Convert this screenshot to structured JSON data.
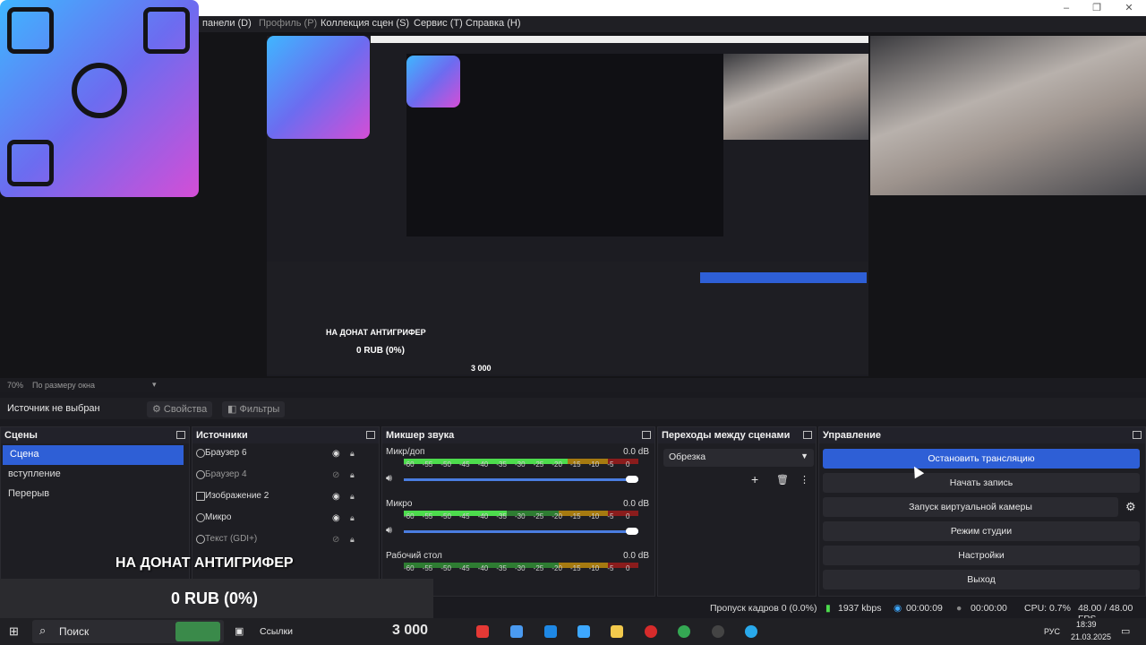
{
  "menu": {
    "items": [
      {
        "label": "панели (D)",
        "dim": false
      },
      {
        "label": "Профиль (P)",
        "dim": true
      },
      {
        "label": "Коллекция сцен (S)",
        "dim": false
      },
      {
        "label": "Сервис (T)",
        "dim": false
      },
      {
        "label": "Справка (H)",
        "dim": false
      }
    ]
  },
  "preview": {
    "nested_banner": "НА ДОНАТ АНТИГРИФЕР",
    "nested_amount": "0 RUB (0%)",
    "nested_counter": "3 000"
  },
  "zoom": {
    "percent": "70%",
    "mode": "По размеру окна"
  },
  "source_toolbar": {
    "no_source": "Источник не выбран",
    "properties": "Свойства",
    "filters": "Фильтры"
  },
  "scenes": {
    "title": "Сцены",
    "items": [
      "Сцена",
      "вступление",
      "Перерыв"
    ],
    "selected_index": 0
  },
  "sources": {
    "title": "Источники",
    "items": [
      {
        "label": "Браузер 6",
        "visible": true
      },
      {
        "label": "Браузер 4",
        "visible": false
      },
      {
        "label": "Изображение 2",
        "visible": true
      },
      {
        "label": "Микро",
        "visible": true
      },
      {
        "label": "Текст (GDI+)",
        "visible": false
      },
      {
        "label": "",
        "visible": false
      }
    ]
  },
  "mixer": {
    "title": "Микшер звука",
    "channels": [
      {
        "name": "Микр/доп",
        "db": "0.0 dB",
        "level": 0.7
      },
      {
        "name": "Микро",
        "db": "0.0 dB",
        "level": 0.44
      },
      {
        "name": "Рабочий стол",
        "db": "0.0 dB",
        "level": 0.0
      }
    ],
    "ticks": [
      "-60",
      "-55",
      "-50",
      "-45",
      "-40",
      "-35",
      "-30",
      "-25",
      "-20",
      "-15",
      "-10",
      "-5",
      "0"
    ]
  },
  "transitions": {
    "title": "Переходы между сценами",
    "selected": "Обрезка"
  },
  "controls": {
    "title": "Управление",
    "stop_stream": "Остановить трансляцию",
    "start_record": "Начать запись",
    "virtual_cam": "Запуск виртуальной камеры",
    "studio_mode": "Режим студии",
    "settings": "Настройки",
    "exit": "Выход"
  },
  "status": {
    "dropped": "Пропуск кадров 0 (0.0%)",
    "bitrate": "1937 kbps",
    "stream_time": "00:00:09",
    "rec_time": "00:00:00",
    "cpu": "CPU: 0.7%",
    "fps": "48.00 / 48.00 FPS"
  },
  "overlay": {
    "banner": "НА ДОНАТ АНТИГРИФЕР",
    "amount": "0 RUB (0%)"
  },
  "taskbar": {
    "search": "Поиск",
    "links": "Ссылки",
    "counter": "3 000",
    "lang": "РУС",
    "time": "18:39",
    "date": "21.03.2025"
  },
  "colors": {
    "accent": "#2e5fd6",
    "bg": "#1e1e23"
  }
}
